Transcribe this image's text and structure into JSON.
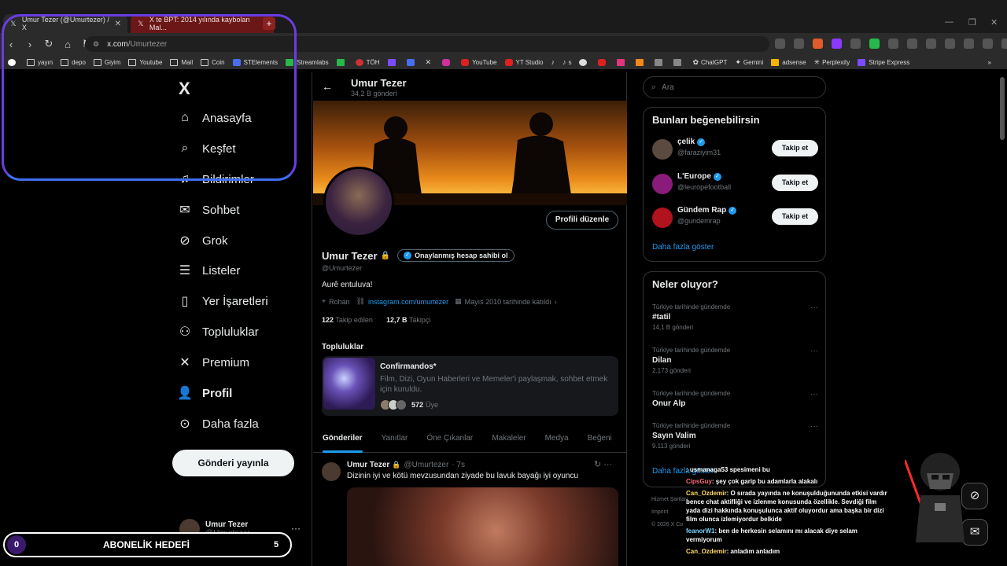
{
  "browser": {
    "tabs": [
      {
        "label": "Umur Tezer (@Umurtezer) / X",
        "active": true
      },
      {
        "label": "X te BPT: 2014 yılında kaybolan Mal...",
        "active": false
      }
    ],
    "url_host": "x.com",
    "url_path": "/Umurtezer",
    "bookmarks": [
      "yayın",
      "depo",
      "Giyim",
      "Youtube",
      "Mail",
      "Coin",
      "STElements",
      "Streamlabs",
      "TÖH",
      "YouTube",
      "YT Studio",
      "s",
      "ChatGPT",
      "Gemini",
      "adsense",
      "Perplexity",
      "Stripe Express"
    ],
    "overflow_icon": "»"
  },
  "nav": {
    "logo": "X",
    "items": [
      {
        "label": "Anasayfa",
        "icon": "home-icon"
      },
      {
        "label": "Keşfet",
        "icon": "search-icon"
      },
      {
        "label": "Bildirimler",
        "icon": "bell-icon"
      },
      {
        "label": "Sohbet",
        "icon": "mail-icon"
      },
      {
        "label": "Grok",
        "icon": "grok-icon"
      },
      {
        "label": "Listeler",
        "icon": "list-icon"
      },
      {
        "label": "Yer İşaretleri",
        "icon": "bookmark-icon"
      },
      {
        "label": "Topluluklar",
        "icon": "people-icon"
      },
      {
        "label": "Premium",
        "icon": "x-icon"
      },
      {
        "label": "Profil",
        "icon": "person-icon"
      },
      {
        "label": "Daha fazla",
        "icon": "more-circle-icon"
      }
    ],
    "post_button": "Gönderi yayınla",
    "account_name": "Umur Tezer",
    "account_handle": "@Umurtezer"
  },
  "profile": {
    "header_name": "Umur Tezer",
    "post_count": "34,2 B gönderi",
    "edit_button": "Profili düzenle",
    "name": "Umur Tezer",
    "verify_pill": "Onaylanmış hesap sahibi ol",
    "handle": "@Umurtezer",
    "bio": "Aurê entuluva!",
    "location": "Rohan",
    "link": "instagram.com/umurtezer",
    "joined": "Mayıs 2010 tarihinde katıldı",
    "following_count": "122",
    "following_label": "Takip edilen",
    "followers_count": "12,7 B",
    "followers_label": "Takipçi",
    "communities_title": "Topluluklar",
    "community": {
      "name": "Confirmandos*",
      "description": "Film, Dizi, Oyun Haberleri ve Memeler'i paylaşmak, sohbet etmek için kuruldu.",
      "members_count": "572",
      "members_label": "Üye"
    },
    "tabs": [
      "Gönderiler",
      "Yanıtlar",
      "Öne Çıkanlar",
      "Makaleler",
      "Medya",
      "Beğeni"
    ],
    "tweet": {
      "name": "Umur Tezer",
      "handle": "@Umurtezer",
      "time": "· 7s",
      "text": "Dizinin iyi ve kötü mevzusundan ziyade bu lavuk bayağı iyi oyuncu"
    }
  },
  "sidebar": {
    "search_placeholder": "Ara",
    "who_to_follow_title": "Bunları beğenebilirsin",
    "suggestions": [
      {
        "name": "çelik",
        "handle": "@faraziyim31",
        "button": "Takip et",
        "color": "#5a4a40"
      },
      {
        "name": "L'Europe",
        "handle": "@leuropefootball",
        "button": "Takip et",
        "color": "#8a1b7a"
      },
      {
        "name": "Gündem Rap",
        "handle": "@gundemrap",
        "button": "Takip et",
        "color": "#b0121e"
      }
    ],
    "show_more": "Daha fazla göster",
    "trends_title": "Neler oluyor?",
    "trends": [
      {
        "meta": "Türkiye tarihinde gündemde",
        "name": "#tatil",
        "count": "14,1 B gönderi"
      },
      {
        "meta": "Türkiye tarihinde gündemde",
        "name": "Dilan",
        "count": "2.173 gönderi"
      },
      {
        "meta": "Türkiye tarihinde gündemde",
        "name": "Onur Alp",
        "count": ""
      },
      {
        "meta": "Türkiye tarihinde gündemde",
        "name": "Sayın Valim",
        "count": "9.113 gönderi"
      }
    ],
    "trends_show_more": "Daha fazla göster",
    "footer_1": "Hizmet Şartları",
    "footer_2": "Imprint",
    "footer_3": "© 2026 X Co"
  },
  "stream": {
    "sub_goal_label": "ABONELİK HEDEFİ",
    "sub_goal_current": "0",
    "sub_goal_target": "5",
    "chat": [
      {
        "user": "",
        "text": ": usmanaga53 spesimeni bu",
        "color": "r"
      },
      {
        "user": "CipsGuy",
        "text": ": şey çok garip bu adamlarla alakalı",
        "color": "r"
      },
      {
        "user": "Can_Ozdemir",
        "text": ": O sırada yayında ne konuşulduğununda etkisi vardır bence chat aktifliği ve izlenme konusunda özellikle. Sevdiği film yada dizi hakkında konuşulunca aktif oluyordur ama başka bir dizi film olunca izlemiyordur belkide",
        "color": "g"
      },
      {
        "user": "feanorW1",
        "text": ": ben de herkesin selamını mı alacak diye selam vermiyorum",
        "color": "b"
      },
      {
        "user": "Can_Ozdemir",
        "text": ": anladım anladım",
        "color": "g"
      }
    ]
  }
}
